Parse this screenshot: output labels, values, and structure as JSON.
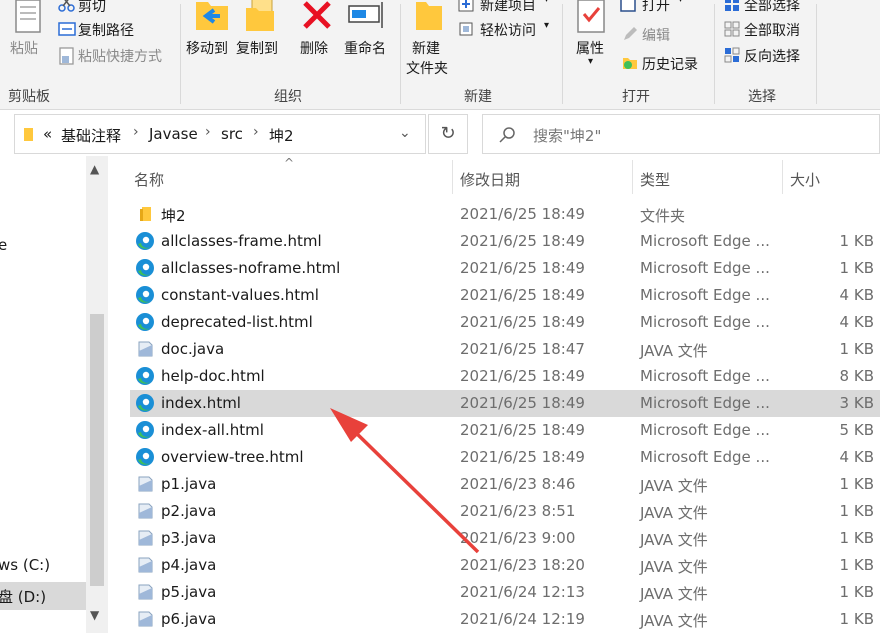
{
  "ribbon": {
    "clipboard": {
      "paste_label": "粘贴",
      "cut_label": "剪切",
      "copy_path_label": "复制路径",
      "paste_shortcut_label": "粘贴快捷方式",
      "group_label": "剪贴板"
    },
    "organize": {
      "move_to_label": "移动到",
      "copy_to_label": "复制到",
      "delete_label": "删除",
      "rename_label": "重命名",
      "group_label": "组织"
    },
    "new": {
      "new_item_label": "新建项目",
      "easy_access_label": "轻松访问",
      "new_folder_line1": "新建",
      "new_folder_line2": "文件夹",
      "group_label": "新建"
    },
    "open": {
      "properties_label": "属性",
      "open_label": "打开",
      "edit_label": "编辑",
      "history_label": "历史记录",
      "group_label": "打开"
    },
    "select": {
      "select_all_label": "全部选择",
      "select_none_label": "全部取消",
      "invert_label": "反向选择",
      "group_label": "选择"
    }
  },
  "address": {
    "overflow": "«",
    "crumbs": [
      "基础注释",
      "Javase",
      "src",
      "坤2"
    ]
  },
  "search": {
    "placeholder": "搜索\"坤2\""
  },
  "nav": {
    "partial_item": "e",
    "drive_c": "ws (C:)",
    "drive_d": "盘 (D:)"
  },
  "columns": {
    "name": "名称",
    "modified": "修改日期",
    "type": "类型",
    "size": "大小"
  },
  "files": [
    {
      "name": "坤2",
      "modified": "2021/6/25 18:49",
      "type": "文件夹",
      "size": "",
      "icon": "folder-icon",
      "selected": false
    },
    {
      "name": "allclasses-frame.html",
      "modified": "2021/6/25 18:49",
      "type": "Microsoft Edge ...",
      "size": "1 KB",
      "icon": "edge-icon",
      "selected": false
    },
    {
      "name": "allclasses-noframe.html",
      "modified": "2021/6/25 18:49",
      "type": "Microsoft Edge ...",
      "size": "1 KB",
      "icon": "edge-icon",
      "selected": false
    },
    {
      "name": "constant-values.html",
      "modified": "2021/6/25 18:49",
      "type": "Microsoft Edge ...",
      "size": "4 KB",
      "icon": "edge-icon",
      "selected": false
    },
    {
      "name": "deprecated-list.html",
      "modified": "2021/6/25 18:49",
      "type": "Microsoft Edge ...",
      "size": "4 KB",
      "icon": "edge-icon",
      "selected": false
    },
    {
      "name": "doc.java",
      "modified": "2021/6/25 18:47",
      "type": "JAVA 文件",
      "size": "1 KB",
      "icon": "java-file-icon",
      "selected": false
    },
    {
      "name": "help-doc.html",
      "modified": "2021/6/25 18:49",
      "type": "Microsoft Edge ...",
      "size": "8 KB",
      "icon": "edge-icon",
      "selected": false
    },
    {
      "name": "index.html",
      "modified": "2021/6/25 18:49",
      "type": "Microsoft Edge ...",
      "size": "3 KB",
      "icon": "edge-icon",
      "selected": true
    },
    {
      "name": "index-all.html",
      "modified": "2021/6/25 18:49",
      "type": "Microsoft Edge ...",
      "size": "5 KB",
      "icon": "edge-icon",
      "selected": false
    },
    {
      "name": "overview-tree.html",
      "modified": "2021/6/25 18:49",
      "type": "Microsoft Edge ...",
      "size": "4 KB",
      "icon": "edge-icon",
      "selected": false
    },
    {
      "name": "p1.java",
      "modified": "2021/6/23 8:46",
      "type": "JAVA 文件",
      "size": "1 KB",
      "icon": "java-file-icon",
      "selected": false
    },
    {
      "name": "p2.java",
      "modified": "2021/6/23 8:51",
      "type": "JAVA 文件",
      "size": "1 KB",
      "icon": "java-file-icon",
      "selected": false
    },
    {
      "name": "p3.java",
      "modified": "2021/6/23 9:00",
      "type": "JAVA 文件",
      "size": "1 KB",
      "icon": "java-file-icon",
      "selected": false
    },
    {
      "name": "p4.java",
      "modified": "2021/6/23 18:20",
      "type": "JAVA 文件",
      "size": "1 KB",
      "icon": "java-file-icon",
      "selected": false
    },
    {
      "name": "p5.java",
      "modified": "2021/6/24 12:13",
      "type": "JAVA 文件",
      "size": "1 KB",
      "icon": "java-file-icon",
      "selected": false
    },
    {
      "name": "p6.java",
      "modified": "2021/6/24 12:19",
      "type": "JAVA 文件",
      "size": "1 KB",
      "icon": "java-file-icon",
      "selected": false
    }
  ],
  "colors": {
    "selection": "#d9d9d9",
    "annotation_arrow": "#e8413b",
    "edge_blue": "#1a8fd6",
    "edge_green": "#3fbf5a",
    "folder_yellow": "#ffc83d",
    "delete_red": "#e81123"
  },
  "annotation": {
    "icon": "red-arrow-icon",
    "points_to": "index.html"
  }
}
